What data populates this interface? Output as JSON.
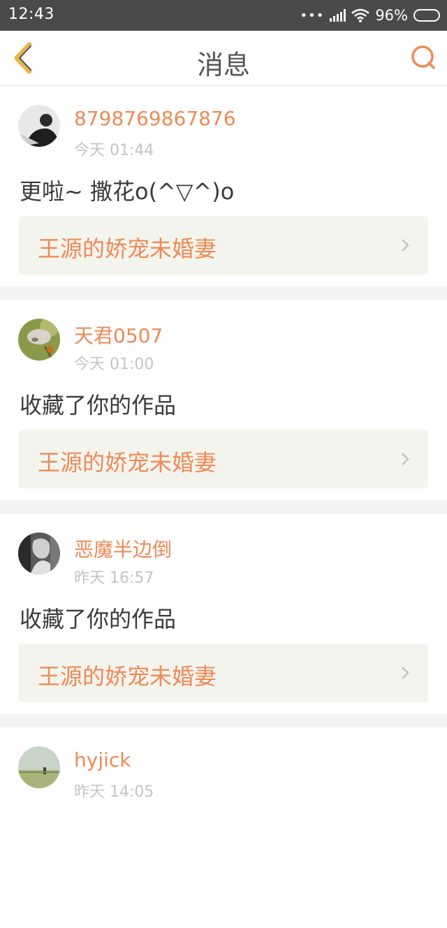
{
  "status": {
    "time": "12:43",
    "dots": "•••",
    "battery": "96%"
  },
  "header": {
    "title": "消息"
  },
  "colors": {
    "accent": "#ee8a55",
    "status_bar": "#4a4a4a",
    "card_link_bg": "#f4f4ee"
  },
  "messages": [
    {
      "username": "8798769867876",
      "time": "今天 01:44",
      "content": "更啦~ 撒花o(^▽^)o",
      "work": "王源的娇宠未婚妻"
    },
    {
      "username": "天君0507",
      "time": "今天 01:00",
      "content": "收藏了你的作品",
      "work": "王源的娇宠未婚妻"
    },
    {
      "username": "恶魔半边倒",
      "time": "昨天 16:57",
      "content": "收藏了你的作品",
      "work": "王源的娇宠未婚妻"
    },
    {
      "username": "hyjick",
      "time": "昨天 14:05"
    }
  ]
}
